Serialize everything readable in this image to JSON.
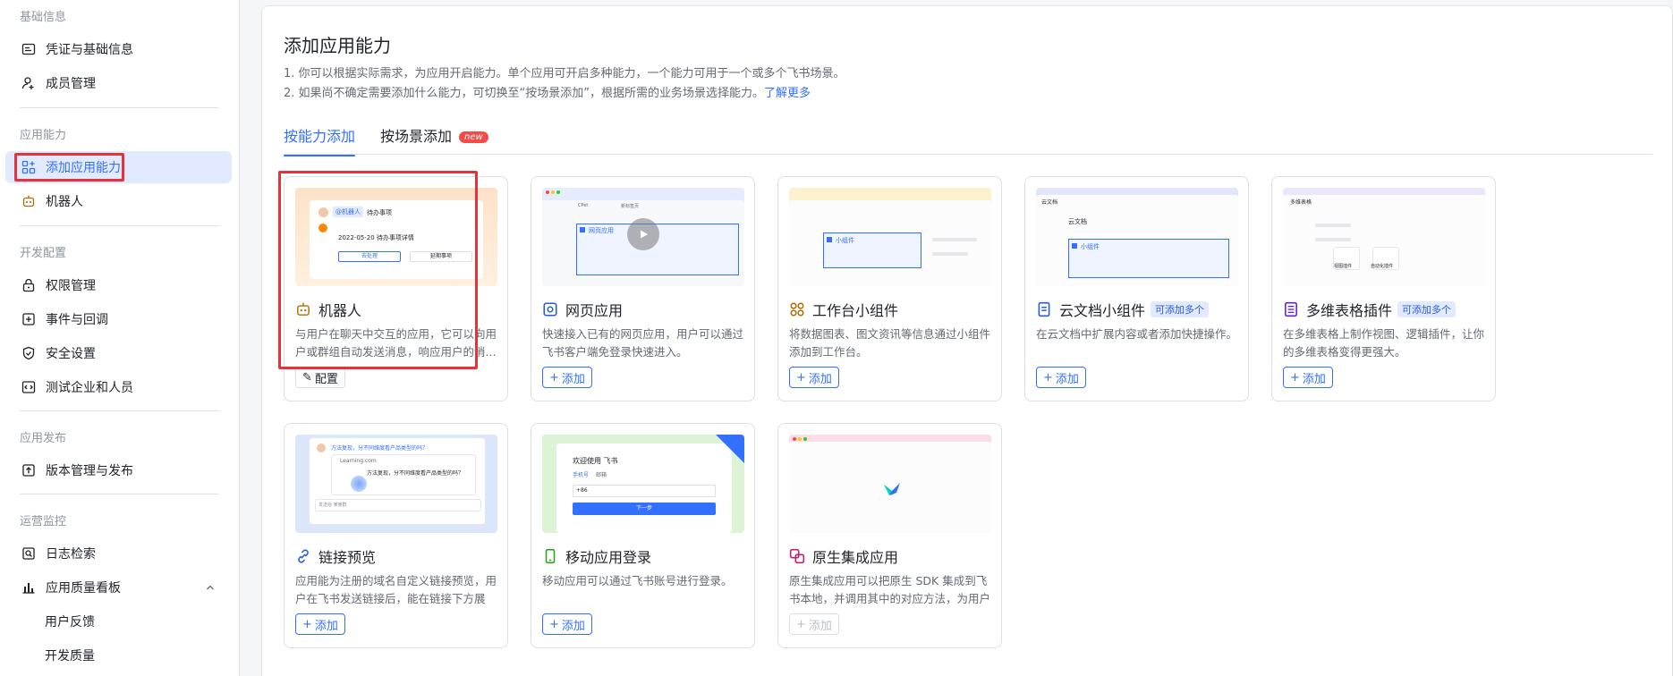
{
  "sidebar": {
    "sections": [
      {
        "title": "基础信息",
        "items": [
          "凭证与基础信息",
          "成员管理"
        ]
      },
      {
        "title": "应用能力",
        "items": [
          "添加应用能力",
          "机器人"
        ]
      },
      {
        "title": "开发配置",
        "items": [
          "权限管理",
          "事件与回调",
          "安全设置",
          "测试企业和人员"
        ]
      },
      {
        "title": "应用发布",
        "items": [
          "版本管理与发布"
        ]
      },
      {
        "title": "运营监控",
        "items": [
          "日志检索",
          "应用质量看板",
          "用户反馈",
          "开发质量"
        ]
      }
    ],
    "active_item": "添加应用能力"
  },
  "main": {
    "title": "添加应用能力",
    "desc1": "1. 你可以根据实际需求，为应用开启能力。单个应用可开启多种能力，一个能力可用于一个或多个飞书场景。",
    "desc2": "2. 如果尚不确定需要添加什么能力，可切换至“按场景添加”，根据所需的业务场景选择能力。",
    "learn_more": "了解更多",
    "tabs": [
      "按能力添加",
      "按场景添加"
    ],
    "new_badge": "new",
    "accent": "#3370ff"
  },
  "cards": [
    {
      "title": "机器人",
      "icon": "robot-icon",
      "desc": "与用户在聊天中交互的应用，它可以向用户或群组自动发送消息，响应用户的消...",
      "button": "配置",
      "preview": {
        "chip": "@机器人",
        "chip2": "待办事项",
        "line": "2022-05-20 待办事项详情",
        "b1": "去处理",
        "b2": "延期事项"
      }
    },
    {
      "title": "网页应用",
      "icon": "web-app-icon",
      "desc": "快速接入已有的网页应用，用户可以通过飞书客户端免登录快速进入。",
      "button": "添加",
      "preview": {
        "tab1": "CPet",
        "tab2": "新标签页",
        "label": "网页应用"
      }
    },
    {
      "title": "工作台小组件",
      "icon": "widget-icon",
      "desc": "将数据图表、图文资讯等信息通过小组件添加到工作台。",
      "button": "添加",
      "preview": {
        "label": "小组件"
      }
    },
    {
      "title": "云文档小组件",
      "badge": "可添加多个",
      "icon": "doc-icon",
      "desc": "在云文档中扩展内容或者添加快捷操作。",
      "button": "添加",
      "preview": {
        "header": "云文档",
        "doc": "云文档",
        "label": "小组件"
      }
    },
    {
      "title": "多维表格插件",
      "badge": "可添加多个",
      "icon": "bitable-icon",
      "desc": "在多维表格上制作视图、逻辑插件，让你的多维表格变得更强大。",
      "button": "添加",
      "preview": {
        "header": "多维表格",
        "p1": "视图插件",
        "p2": "自动化插件"
      }
    },
    {
      "title": "链接预览",
      "icon": "link-icon",
      "desc": "应用能为注册的域名自定义链接预览，用户在飞书发送链接后，能在链接下方展示...",
      "button": "添加",
      "preview": {
        "msg": "方法复现，分不同维度看产品类型的吗？",
        "url": "Learning.com",
        "msg2": "方法复现，分不同维度看产品类型的吗？",
        "input": "发送给 某某群"
      }
    },
    {
      "title": "移动应用登录",
      "icon": "mobile-icon",
      "desc": "移动应用可以通过飞书账号进行登录。",
      "button": "添加",
      "preview": {
        "welcome": "欢迎使用 飞书",
        "t1": "手机号",
        "t2": "邮箱",
        "code": "+86",
        "next": "下一步"
      }
    },
    {
      "title": "原生集成应用",
      "icon": "native-icon",
      "desc": "原生集成应用可以把原生 SDK 集成到飞书本地，并调用其中的对应方法，为用户提...",
      "button": "添加",
      "disabled": true
    }
  ]
}
